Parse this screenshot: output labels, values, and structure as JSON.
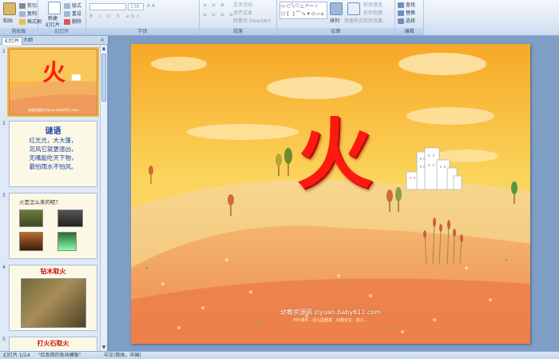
{
  "ribbon": {
    "clipboard": {
      "paste": "粘贴",
      "cut": "剪切",
      "copy": "复制",
      "format_painter": "格式刷",
      "label": "剪贴板"
    },
    "slides": {
      "new_slide": "新建",
      "new_slide2": "幻灯片",
      "layout": "版式",
      "reset": "重设",
      "delete": "删除",
      "label": "幻灯片"
    },
    "font": {
      "font_size": "138",
      "label": "字体"
    },
    "paragraph": {
      "text_direction": "文字方向",
      "align_text": "对齐文本",
      "smartart": "转换为 SmartArt",
      "label": "段落"
    },
    "drawing": {
      "arrange": "排列",
      "quick_styles": "快速样式",
      "shape_fill": "形状填充",
      "shape_outline": "形状轮廓",
      "shape_effects": "形状效果",
      "label": "绘图"
    },
    "editing": {
      "find": "查找",
      "replace": "替换",
      "select": "选择",
      "label": "编辑"
    }
  },
  "panel": {
    "tab_slides": "幻灯片",
    "tab_outline": "大纲",
    "close": "×"
  },
  "thumbs": [
    {
      "num": "1",
      "title": "火",
      "footer": "幼教资源网 ziyuan.baby611.com"
    },
    {
      "num": "2",
      "title": "谜语",
      "lines": [
        "红光光，大大篷，",
        "见风它就更逞凶，",
        "无嘴能吃天下物，",
        "最怕雨水不怕风。"
      ]
    },
    {
      "num": "3",
      "question": "火是怎么来的呢？"
    },
    {
      "num": "4",
      "caption": "钻木取火"
    },
    {
      "num": "5",
      "caption": "打火石取火"
    }
  ],
  "slide": {
    "title": "火",
    "watermark": "幼教资源网 ziyuan.baby611.com",
    "watermark_sub": "PPT课件 · 幼儿园教案 · 幼教论文 · 亲子..."
  },
  "status": {
    "slide_index": "幻灯片 1/14",
    "theme": "\"红色简约色块模板\"",
    "language": "中文(简体，中国)"
  },
  "colors": {
    "title_red": "#ff1a10",
    "ribbon_bg": "#dbe6f4",
    "selection": "#f0b64a"
  }
}
